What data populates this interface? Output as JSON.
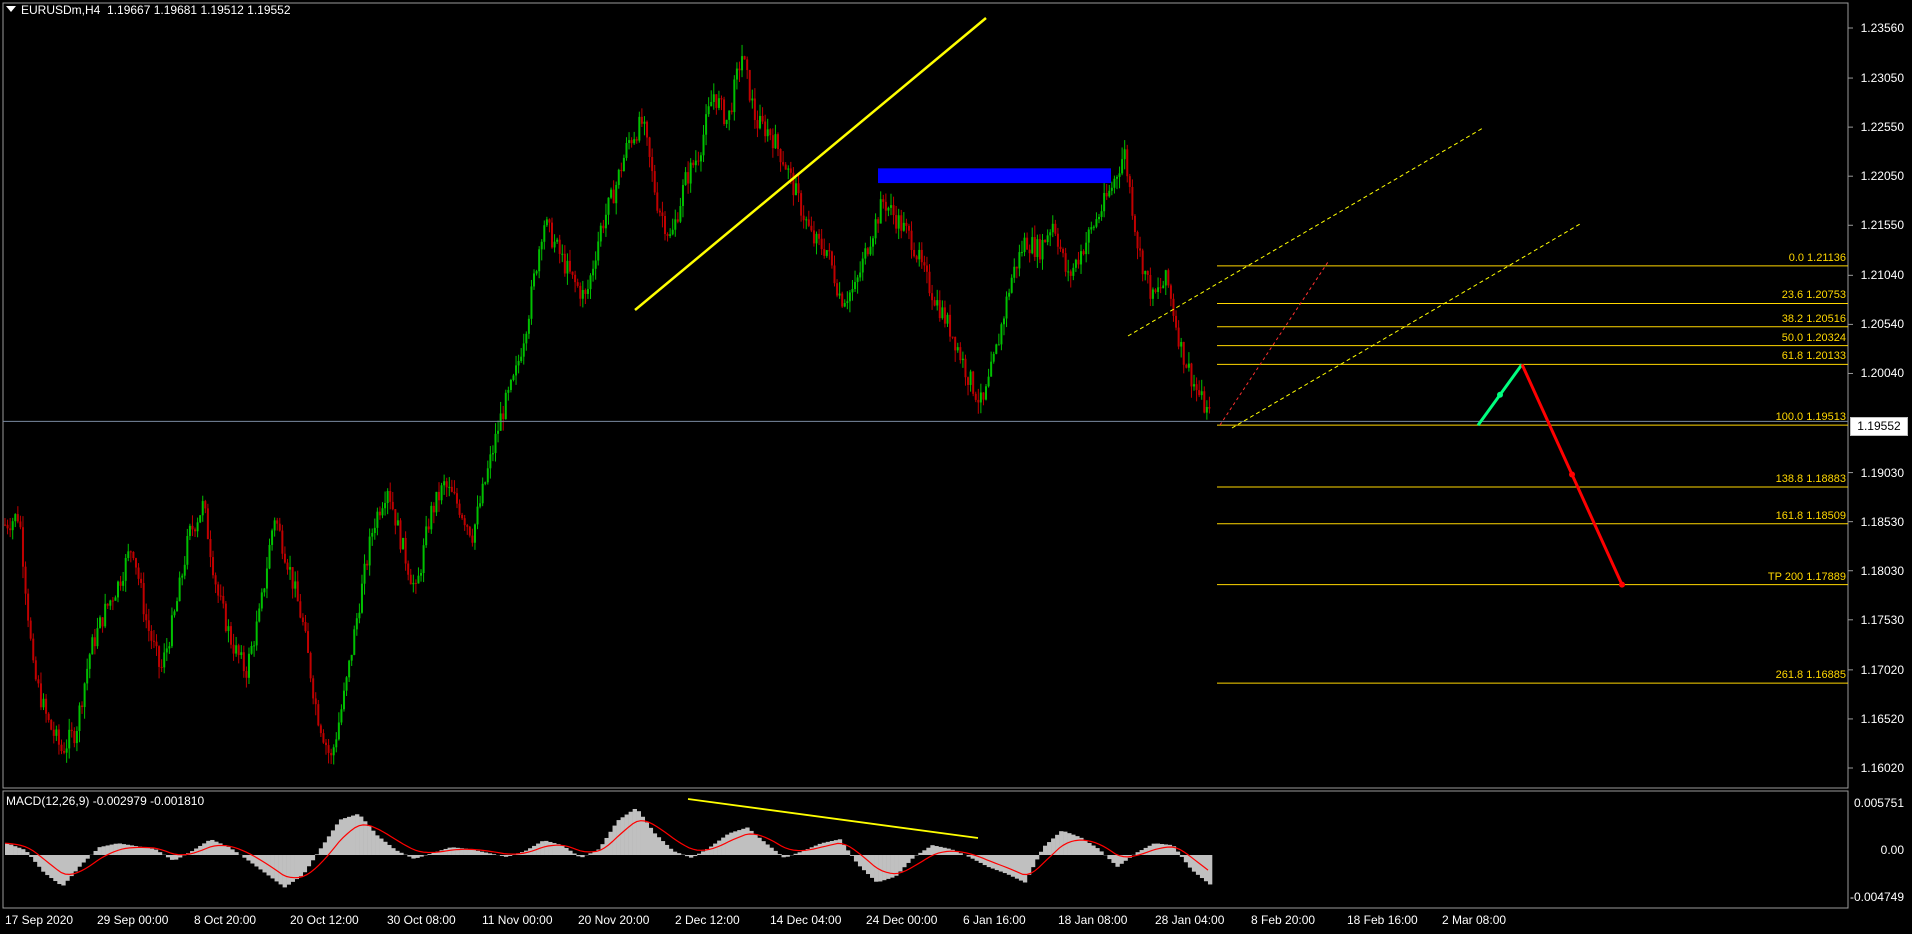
{
  "header": {
    "symbol": "EURUSDm,H4",
    "ohlc": "1.19667 1.19681 1.19512 1.19552"
  },
  "price_axis": [
    "1.23560",
    "1.23050",
    "1.22550",
    "1.22050",
    "1.21550",
    "1.21040",
    "1.20540",
    "1.20040",
    "1.19030",
    "1.18530",
    "1.18030",
    "1.17530",
    "1.17020",
    "1.16520",
    "1.16020"
  ],
  "current_price": "1.19552",
  "time_axis": [
    "17 Sep 2020",
    "29 Sep 00:00",
    "8 Oct 20:00",
    "20 Oct 12:00",
    "30 Oct 08:00",
    "11 Nov 00:00",
    "20 Nov 20:00",
    "2 Dec 12:00",
    "14 Dec 04:00",
    "24 Dec 00:00",
    "6 Jan 16:00",
    "18 Jan 08:00",
    "28 Jan 04:00",
    "8 Feb 20:00",
    "18 Feb 16:00",
    "2 Mar 08:00"
  ],
  "fibonacci": [
    {
      "label": "0.0 1.21136",
      "price": 1.21136
    },
    {
      "label": "23.6 1.20753",
      "price": 1.20753
    },
    {
      "label": "38.2 1.20516",
      "price": 1.20516
    },
    {
      "label": "50.0 1.20324",
      "price": 1.20324
    },
    {
      "label": "61.8 1.20133",
      "price": 1.20133
    },
    {
      "label": "100.0 1.19513",
      "price": 1.19513
    },
    {
      "label": "138.8 1.18883",
      "price": 1.18883
    },
    {
      "label": "161.8 1.18509",
      "price": 1.18509
    },
    {
      "label": "TP 200 1.17889",
      "price": 1.17889
    },
    {
      "label": "261.8 1.16885",
      "price": 1.16885
    }
  ],
  "macd": {
    "label": "MACD(12,26,9) -0.002979 -0.001810",
    "axis": [
      "0.005751",
      "0.00",
      "-0.004749"
    ]
  },
  "colors": {
    "background": "#000000",
    "bull": "#00c000",
    "bear": "#c00000",
    "fib": "#ffd700",
    "trendline": "#ffff00",
    "zone": "#0000ff",
    "signal": "#ff0000",
    "histogram": "#c0c0c0",
    "projection_up": "#00ff7f",
    "projection_down": "#ff0000"
  },
  "chart_data": {
    "type": "candlestick",
    "symbol": "EURUSDm",
    "timeframe": "H4",
    "ylim": [
      1.1577,
      1.2376
    ],
    "x_ticks": [
      "17 Sep 2020",
      "29 Sep 00:00",
      "8 Oct 20:00",
      "20 Oct 12:00",
      "30 Oct 08:00",
      "11 Nov 00:00",
      "20 Nov 20:00",
      "2 Dec 12:00",
      "14 Dec 04:00",
      "24 Dec 00:00",
      "6 Jan 16:00",
      "18 Jan 08:00",
      "28 Jan 04:00",
      "8 Feb 20:00",
      "18 Feb 16:00",
      "2 Mar 08:00"
    ],
    "price_path": [
      [
        1.185,
        1.186
      ],
      [
        1.17,
        1.165
      ],
      [
        1.162,
        1.164
      ],
      [
        1.172,
        1.176
      ],
      [
        1.179,
        1.183
      ],
      [
        1.175,
        1.17
      ],
      [
        1.176,
        1.184
      ],
      [
        1.187,
        1.178
      ],
      [
        1.173,
        1.17
      ],
      [
        1.176,
        1.186
      ],
      [
        1.181,
        1.175
      ],
      [
        1.166,
        1.161
      ],
      [
        1.168,
        1.177
      ],
      [
        1.185,
        1.189
      ],
      [
        1.183,
        1.178
      ],
      [
        1.186,
        1.189
      ],
      [
        1.187,
        1.184
      ],
      [
        1.19,
        1.196
      ],
      [
        1.2,
        1.207
      ],
      [
        1.216,
        1.213
      ],
      [
        1.21,
        1.208
      ],
      [
        1.215,
        1.219
      ],
      [
        1.224,
        1.226
      ],
      [
        1.218,
        1.214
      ],
      [
        1.22,
        1.223
      ],
      [
        1.229,
        1.226
      ],
      [
        1.233,
        1.226
      ],
      [
        1.225,
        1.222
      ],
      [
        1.218,
        1.214
      ],
      [
        1.213,
        1.208
      ],
      [
        1.209,
        1.214
      ],
      [
        1.218,
        1.216
      ],
      [
        1.214,
        1.21
      ],
      [
        1.207,
        1.204
      ],
      [
        1.2,
        1.197
      ],
      [
        1.203,
        1.21
      ],
      [
        1.214,
        1.213
      ],
      [
        1.216,
        1.21
      ],
      [
        1.213,
        1.216
      ],
      [
        1.219,
        1.223
      ],
      [
        1.213,
        1.208
      ],
      [
        1.21,
        1.203
      ],
      [
        1.199,
        1.196
      ]
    ],
    "horizontal_line": 1.19552,
    "rectangle_zone": {
      "from_price": 1.2213,
      "to_price": 1.2198
    },
    "projection": [
      1.19512,
      1.20133,
      1.17889
    ],
    "macd": {
      "ylim": [
        -0.004749,
        0.005751
      ],
      "histogram": [
        0.0012,
        0.0005,
        -0.0018,
        -0.0032,
        -0.001,
        0.0008,
        0.0012,
        0.0009,
        0.0006,
        -0.0006,
        0.0004,
        0.0016,
        0.0008,
        -0.0005,
        -0.0019,
        -0.0033,
        -0.002,
        0.0008,
        0.0036,
        0.0042,
        0.002,
        0.0005,
        -0.0004,
        0.0002,
        0.0008,
        0.0006,
        0.0002,
        -0.0002,
        0.0004,
        0.0015,
        0.001,
        -0.0003,
        0.0006,
        0.0035,
        0.0048,
        0.0022,
        0.0004,
        -0.0003,
        0.0008,
        0.0022,
        0.0028,
        0.0012,
        -0.0003,
        0.0004,
        0.0012,
        0.0016,
        -0.001,
        -0.0028,
        -0.0022,
        -0.0002,
        0.001,
        0.0006,
        -0.0002,
        -0.0012,
        -0.0019,
        -0.0028,
        0.0008,
        0.0025,
        0.0018,
        0.0006,
        -0.0012,
        0.0002,
        0.0012,
        0.001,
        -0.0015,
        -0.003
      ]
    }
  }
}
